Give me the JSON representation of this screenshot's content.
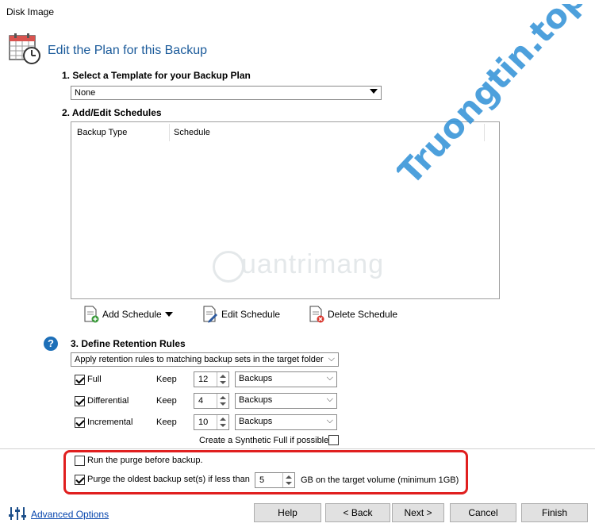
{
  "window": {
    "title": "Disk Image"
  },
  "header": {
    "title": "Edit the Plan for this Backup"
  },
  "template": {
    "heading": "1. Select a Template for your Backup Plan",
    "selected": "None"
  },
  "schedules": {
    "heading": "2. Add/Edit Schedules",
    "columns": [
      "Backup Type",
      "Schedule"
    ],
    "add_label": "Add Schedule",
    "edit_label": "Edit Schedule",
    "delete_label": "Delete Schedule"
  },
  "retention": {
    "heading": "3. Define Retention Rules",
    "mode": "Apply retention rules to matching backup sets in the target folder",
    "keep_label": "Keep",
    "rows": [
      {
        "name": "Full",
        "checked": true,
        "value": "12",
        "unit": "Backups"
      },
      {
        "name": "Differential",
        "checked": true,
        "value": "4",
        "unit": "Backups"
      },
      {
        "name": "Incremental",
        "checked": true,
        "value": "10",
        "unit": "Backups"
      }
    ],
    "synthetic_label": "Create a Synthetic Full if possible",
    "synthetic_checked": false
  },
  "purge": {
    "run_before_label": "Run the purge before backup.",
    "run_before_checked": false,
    "oldest_label": "Purge the oldest backup set(s) if less than",
    "oldest_checked": true,
    "oldest_value": "5",
    "oldest_suffix": "GB on the target volume (minimum 1GB)"
  },
  "footer": {
    "advanced_label": "Advanced Options",
    "help_label": "Help",
    "back_label": "< Back",
    "next_label": "Next >",
    "cancel_label": "Cancel",
    "finish_label": "Finish"
  },
  "watermark": {
    "side": "Truongtin.top",
    "center": "uantrimang"
  },
  "colors": {
    "accent": "#1a5a9a",
    "highlight": "#e01f1f",
    "watermark": "#2e8fd6"
  }
}
